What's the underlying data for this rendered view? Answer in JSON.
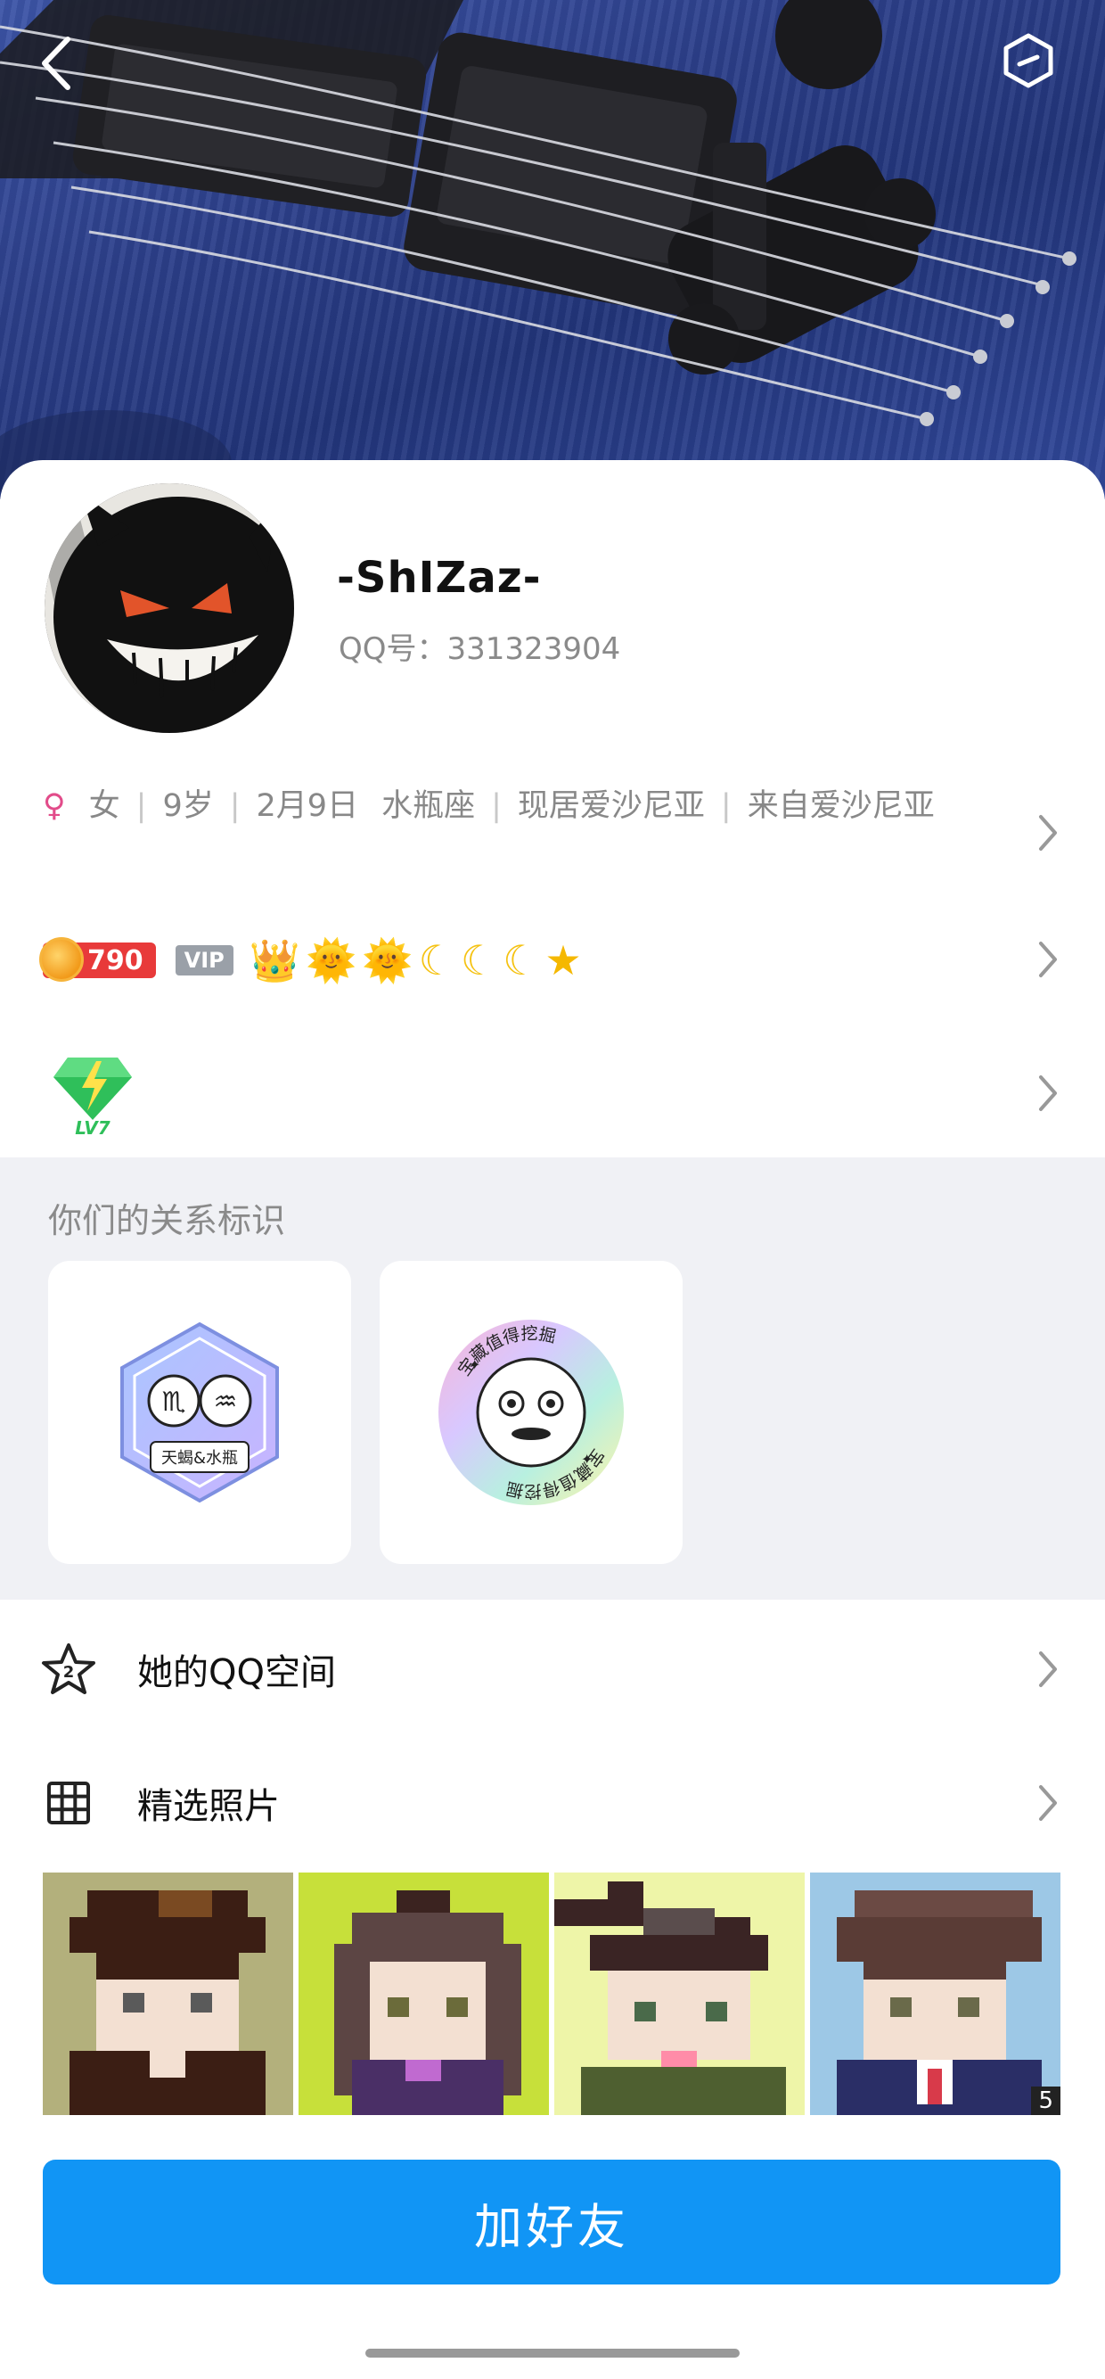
{
  "header": {
    "back_icon": "back-arrow-icon",
    "shield_icon": "shield-hexagon-icon"
  },
  "profile": {
    "nickname": "-ShIZaz-",
    "qq_label": "QQ号：",
    "qq_number": "331323904"
  },
  "info": {
    "gender_icon": "female-icon",
    "gender_symbol": "♀",
    "gender": "女",
    "age": "9岁",
    "birthday": "2月9日",
    "zodiac": "水瓶座",
    "location": "现居爱沙尼亚",
    "hometown": "来自爱沙尼亚"
  },
  "badges": {
    "coin_value": "790",
    "vip_label": "VIP",
    "level_icons": [
      "crown",
      "sun",
      "sun",
      "moon",
      "moon",
      "moon",
      "star"
    ],
    "lv_label": "LV7"
  },
  "relation": {
    "title": "你们的关系标识",
    "cards": [
      {
        "icon": "zodiac-scorpio-aquarius-badge",
        "caption": "天蝎&水瓶"
      },
      {
        "icon": "treasure-worth-digging-badge",
        "caption": "宝藏值得挖掘"
      }
    ]
  },
  "menu": {
    "qzone_label": "她的QQ空间",
    "photos_label": "精选照片"
  },
  "photos": {
    "count": "5"
  },
  "action": {
    "add_friend": "加好友"
  },
  "colors": {
    "accent": "#1195f5",
    "female": "#e24c8a",
    "coin_badge": "#e83a3a",
    "section_bg": "#f0f1f5"
  }
}
